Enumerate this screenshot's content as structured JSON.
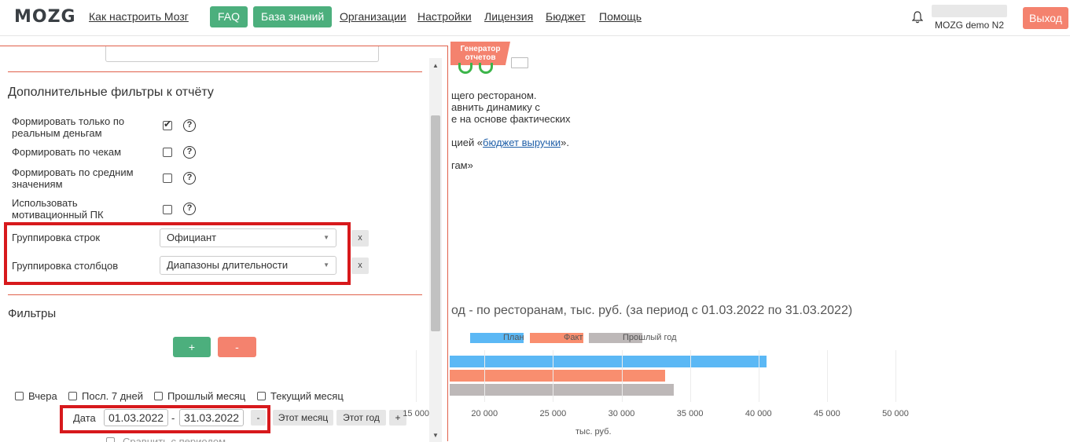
{
  "nav": {
    "logo": "MOZG",
    "how_to": "Как настроить Мозг",
    "faq": "FAQ",
    "knowledge_base": "База знаний",
    "organizations": "Организации",
    "settings": "Настройки",
    "license": "Лицензия",
    "budget": "Бюджет",
    "help": "Помощь",
    "user_name": "MOZG demo N2",
    "logout": "Выход"
  },
  "background": {
    "badge": "Генератор отчетов",
    "line1": "щего рестораном.",
    "line2": "авнить динамику с",
    "line3": "е на основе фактических",
    "line4_prefix": "цией «",
    "line4_link": "бюджет выручки",
    "line4_suffix": "».",
    "line5": "гам»"
  },
  "panel": {
    "additional_filters_title": "Дополнительные фильтры к отчёту",
    "options": [
      {
        "label": "Формировать только по реальным деньгам",
        "checked": true
      },
      {
        "label": "Формировать по чекам",
        "checked": false
      },
      {
        "label": "Формировать по средним значениям",
        "checked": false
      },
      {
        "label": "Использовать мотивационный ПК",
        "checked": false
      }
    ],
    "help_glyph": "?",
    "row_grouping_label": "Группировка строк",
    "row_grouping_value": "Официант",
    "col_grouping_label": "Группировка столбцов",
    "col_grouping_value": "Диапазоны длительности",
    "clear_label": "x",
    "filters_title": "Фильтры",
    "add_filter": "+",
    "remove_filter": "-",
    "periods": [
      {
        "label": "Вчера"
      },
      {
        "label": "Посл. 7 дней"
      },
      {
        "label": "Прошлый месяц"
      },
      {
        "label": "Текущий месяц"
      }
    ],
    "date_label": "Дата",
    "date_from": "01.03.2022",
    "date_sep": "-",
    "date_to": "31.03.2022",
    "date_minus": "-",
    "this_month": "Этот месяц",
    "this_year": "Этот год",
    "date_plus": "+",
    "compare_label": "Сравнить с периодом"
  },
  "chart_data": {
    "type": "bar",
    "orientation": "horizontal",
    "title": "од - по ресторанам, тыс. руб. (за период с 01.03.2022 по 31.03.2022)",
    "xlabel": "тыс. руб.",
    "xlim": [
      10000,
      50000
    ],
    "x_ticks": [
      "15 000",
      "20 000",
      "25 000",
      "30 000",
      "35 000",
      "40 000",
      "45 000",
      "50 000"
    ],
    "series": [
      {
        "name": "План",
        "color": "#5bb8f5",
        "values": [
          40600
        ]
      },
      {
        "name": "Факт",
        "color": "#f98e6f",
        "values": [
          33200
        ]
      },
      {
        "name": "Прошлый год",
        "color": "#bdb8b8",
        "values": [
          33800
        ]
      }
    ],
    "legend": "top",
    "grid": true
  }
}
